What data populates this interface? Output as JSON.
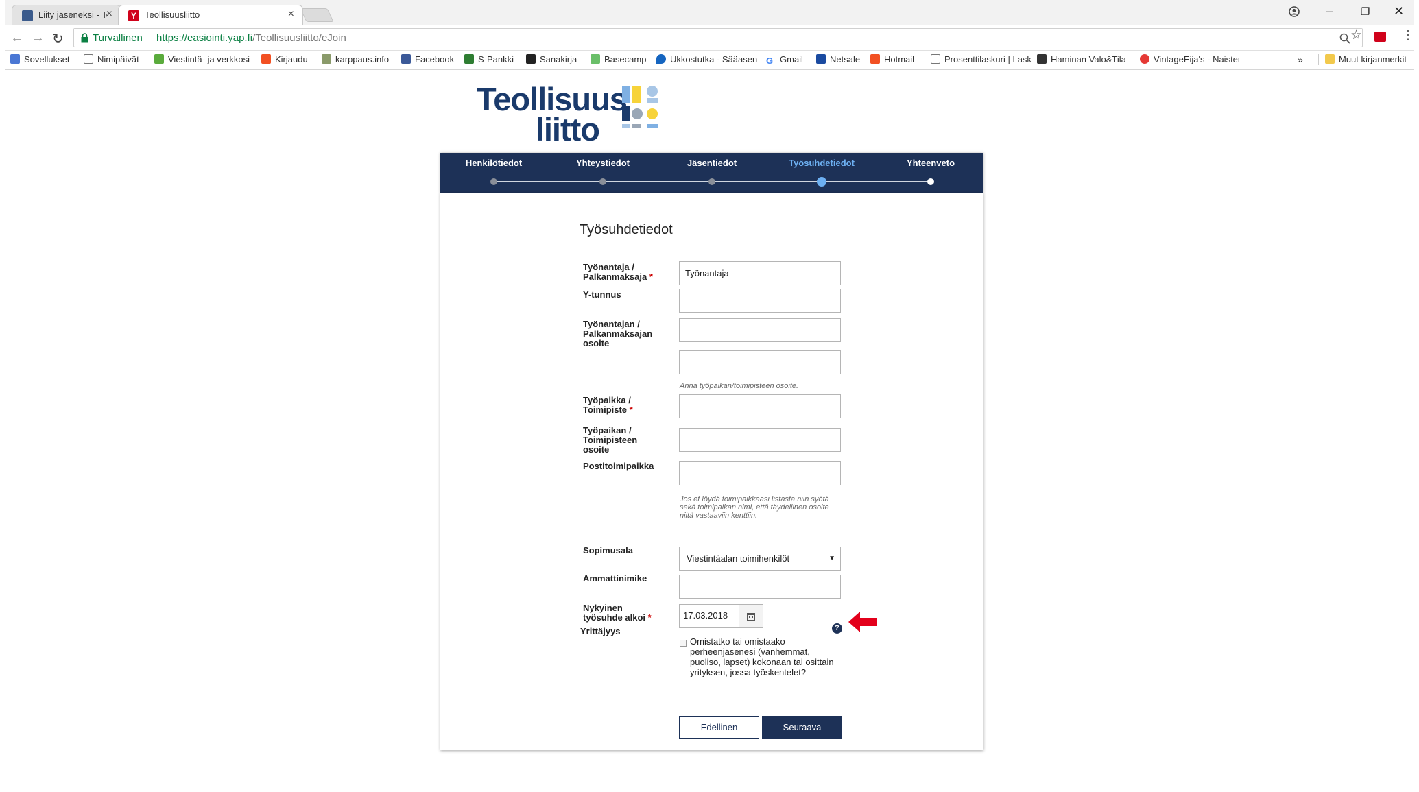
{
  "browser": {
    "tabs": [
      {
        "title": "Liity jäseneksi - Teollisuu",
        "active": false
      },
      {
        "title": "Teollisuusliitto",
        "active": true
      }
    ],
    "secure_label": "Turvallinen",
    "url_host": "https://easiointi.yap.fi",
    "url_path": "/Teollisuusliitto/eJoin",
    "bookmarks": [
      "Sovellukset",
      "Nimipäivät",
      "Viestintä- ja verkkosi",
      "Kirjaudu",
      "karppaus.info",
      "Facebook",
      "S-Pankki",
      "Sanakirja",
      "Basecamp",
      "Ukkostutka - Sääasen",
      "Gmail",
      "Netsale",
      "Hotmail",
      "Prosenttilaskuri | Lask",
      "Haminan Valo&Tila",
      "VintageEija's - Naisten"
    ],
    "bookmarks_more": "»",
    "other_bookmarks": "Muut kirjanmerkit",
    "icons": [
      "back-icon",
      "forward-icon",
      "reload-icon",
      "lock-icon",
      "zoom-icon",
      "star-icon",
      "extension-icon",
      "menu-icon",
      "profile-icon",
      "minimize-icon",
      "restore-icon",
      "close-icon"
    ]
  },
  "logo": {
    "line1": "Teollisuus",
    "line2": "liitto"
  },
  "steps": {
    "items": [
      "Henkilötiedot",
      "Yhteystiedot",
      "Jäsentiedot",
      "Työsuhdetiedot",
      "Yhteenveto"
    ],
    "current": 3
  },
  "form": {
    "title": "Työsuhdetiedot",
    "fields": {
      "employer": {
        "label": "Työnantaja / Palkanmaksaja",
        "required": "*",
        "value": "Työnantaja"
      },
      "ytunnus": {
        "label": "Y-tunnus",
        "value": ""
      },
      "employer_address": {
        "label": "Työnantajan / Palkanmaksajan osoite",
        "value": "",
        "value2": ""
      },
      "employer_address_hint": "Anna työpaikan/toimipisteen osoite.",
      "workplace": {
        "label": "Työpaikka / Toimipiste",
        "required": "*",
        "value": ""
      },
      "workplace_address": {
        "label": "Työpaikan / Toimipisteen osoite",
        "value": ""
      },
      "postal": {
        "label": "Postitoimipaikka",
        "value": ""
      },
      "workplace_hint": "Jos et löydä toimipaikkaasi listasta niin syötä sekä toimipaikan nimi, että täydellinen osoite niitä vastaaviin kenttiin.",
      "agreement": {
        "label": "Sopimusala",
        "selected": "Viestintäalan toimihenkilöt"
      },
      "job_title": {
        "label": "Ammattinimike",
        "value": ""
      },
      "start_date": {
        "label": "Nykyinen työsuhde alkoi",
        "required": "*",
        "value": "17.03.2018"
      },
      "entrepreneurship": {
        "label": "Yrittäjyys",
        "help": "?",
        "checkbox_label": "Omistatko tai omistaako perheenjäsenesi (vanhemmat, puoliso, lapset) kokonaan tai osittain yrityksen, jossa työskentelet?",
        "checked": false
      }
    },
    "buttons": {
      "prev": "Edellinen",
      "next": "Seuraava"
    }
  },
  "colors": {
    "navy": "#1d3157",
    "accent": "#6db0f2",
    "annotation_arrow": "#e3001b"
  }
}
